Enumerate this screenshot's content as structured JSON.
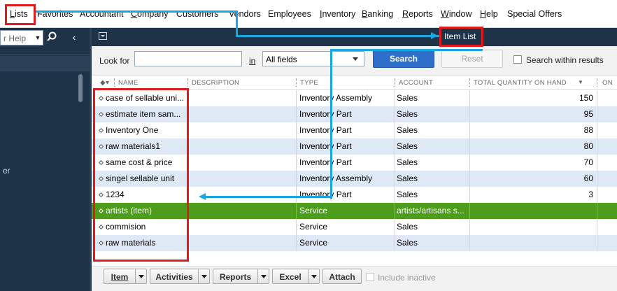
{
  "menu": {
    "items": [
      "Lists",
      "Favorites",
      "Accountant",
      "Company",
      "Customers",
      "Vendors",
      "Employees",
      "Inventory",
      "Banking",
      "Reports",
      "Window",
      "Help",
      "Special Offers"
    ]
  },
  "left_panel": {
    "help_text": "r Help",
    "side_text": "er"
  },
  "window": {
    "title": "Item List"
  },
  "toolbar": {
    "look_for_label": "Look for",
    "look_for_value": "",
    "in_label": "in",
    "field_select": "All fields",
    "search_button": "Search",
    "reset_button": "Reset",
    "search_within_label": "Search within results"
  },
  "table": {
    "headers": {
      "name": "NAME",
      "description": "DESCRIPTION",
      "type": "TYPE",
      "account": "ACCOUNT",
      "total_qty": "TOTAL QUANTITY ON HAND",
      "next": "ON"
    },
    "rows": [
      {
        "name": "case of sellable uni...",
        "description": "",
        "type": "Inventory Assembly",
        "account": "Sales",
        "qty": "150"
      },
      {
        "name": "estimate item sam...",
        "description": "",
        "type": "Inventory Part",
        "account": "Sales",
        "qty": "95"
      },
      {
        "name": "Inventory One",
        "description": "",
        "type": "Inventory Part",
        "account": "Sales",
        "qty": "88"
      },
      {
        "name": "raw materials1",
        "description": "",
        "type": "Inventory Part",
        "account": "Sales",
        "qty": "80"
      },
      {
        "name": "same cost & price",
        "description": "",
        "type": "Inventory Part",
        "account": "Sales",
        "qty": "70"
      },
      {
        "name": "singel sellable unit",
        "description": "",
        "type": "Inventory Assembly",
        "account": "Sales",
        "qty": "60"
      },
      {
        "name": "1234",
        "description": "",
        "type": "Inventory Part",
        "account": "Sales",
        "qty": "3"
      },
      {
        "name": "artists (item)",
        "description": "",
        "type": "Service",
        "account": "artists/artisans s...",
        "qty": "",
        "selected": true
      },
      {
        "name": "commision",
        "description": "",
        "type": "Service",
        "account": "Sales",
        "qty": ""
      },
      {
        "name": "raw materials",
        "description": "",
        "type": "Service",
        "account": "Sales",
        "qty": ""
      }
    ]
  },
  "bottom": {
    "item_button": "Item",
    "activities_button": "Activities",
    "reports_button": "Reports",
    "excel_button": "Excel",
    "attach_button": "Attach",
    "include_inactive_label": "Include inactive"
  },
  "colors": {
    "selected_row": "#4d9c1c",
    "annotation_red": "#e01b1b",
    "annotation_blue": "#1aa7e0",
    "header_dark": "#1e3347"
  }
}
